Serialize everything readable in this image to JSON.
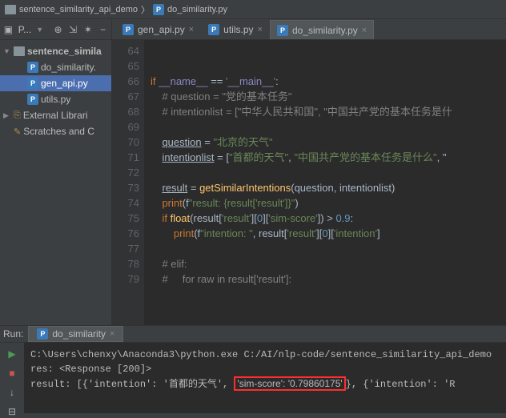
{
  "breadcrumb": {
    "project": "sentence_similarity_api_demo",
    "file": "do_similarity.py"
  },
  "sidebar": {
    "title": "P...",
    "items": [
      {
        "label": "sentence_simila",
        "type": "folder",
        "bold": true
      },
      {
        "label": "do_similarity.",
        "type": "py"
      },
      {
        "label": "gen_api.py",
        "type": "py",
        "selected": true
      },
      {
        "label": "utils.py",
        "type": "py"
      },
      {
        "label": "External Librari",
        "type": "lib"
      },
      {
        "label": "Scratches and C",
        "type": "scratch"
      }
    ]
  },
  "tabs": [
    {
      "label": "gen_api.py"
    },
    {
      "label": "utils.py"
    },
    {
      "label": "do_similarity.py",
      "active": true
    }
  ],
  "editor": {
    "start": 64,
    "lines": [
      "",
      "",
      "if __name__ == '__main__':",
      "    # question = \"党的基本任务\"",
      "    # intentionlist = [\"中华人民共和国\", \"中国共产党的基本任务是什",
      "",
      "    question = \"北京的天气\"",
      "    intentionlist = [\"首都的天气\", \"中国共产党的基本任务是什么\", \"",
      "",
      "    result = getSimilarIntentions(question, intentionlist)",
      "    print(f\"result: {result['result']}\")",
      "    if float(result['result'][0]['sim-score']) > 0.9:",
      "        print(f\"intention: \", result['result'][0]['intention']",
      "",
      "    # elif:",
      "    #     for raw in result['result']:"
    ]
  },
  "run": {
    "label": "Run:",
    "tab": "do_similarity",
    "output": {
      "line1": "C:\\Users\\chenxy\\Anaconda3\\python.exe C:/AI/nlp-code/sentence_similarity_api_demo",
      "line2": "res: <Response [200]>",
      "line3_pre": "result: [{'intention': '首都的天气',",
      "line3_hl": "'sim-score': '0.79860175'",
      "line3_post": ", {'intention': 'R"
    }
  }
}
